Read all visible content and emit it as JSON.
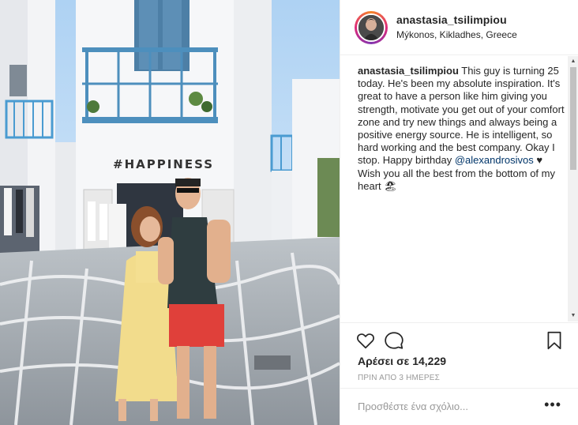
{
  "post": {
    "username": "anastasia_tsilimpiou",
    "location": "Mýkonos, Kikladhes, Greece"
  },
  "caption": {
    "username": "anastasia_tsilimpiou",
    "text_part1": "This guy is turning 25 today. He's been my absolute inspiration. It's great to have a person like him giving you strength, motivate you get out of your comfort zone and try new things and always being a positive energy source. He is intelligent, so hard working and the best company. Okay I stop. Happy birthday",
    "mention": "@alexandrosivos",
    "text_part2": "♥ Wish you all the best from the bottom of my heart",
    "emoji": "🏖"
  },
  "photo": {
    "sign_text": "#HAPPINESS"
  },
  "actions": {
    "like_icon": "heart-icon",
    "comment_icon": "comment-icon",
    "save_icon": "bookmark-icon"
  },
  "likes": "Αρέσει σε 14,229",
  "timestamp": "ΠΡΙΝ ΑΠΟ 3 ΗΜΕΡΕΣ",
  "comment": {
    "placeholder": "Προσθέστε ένα σχόλιο...",
    "more_label": "•••"
  },
  "colors": {
    "text": "#262626",
    "muted": "#999999",
    "mention": "#003569",
    "border": "#efefef",
    "sky": "#cfe3f6",
    "balcony": "#4d8fbd"
  }
}
